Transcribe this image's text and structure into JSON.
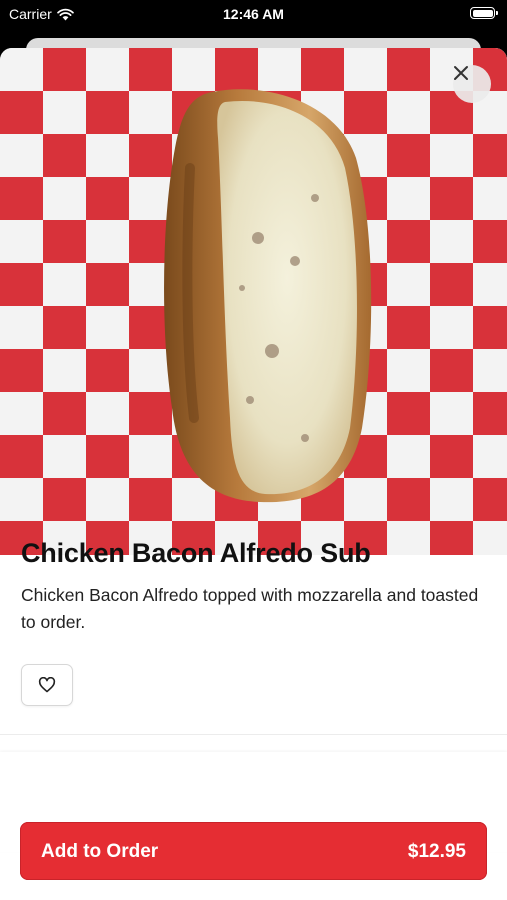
{
  "status_bar": {
    "carrier": "Carrier",
    "time": "12:46 AM"
  },
  "item": {
    "title": "Chicken Bacon Alfredo Sub",
    "description": "Chicken Bacon Alfredo topped with mozzarella and toasted to order."
  },
  "actions": {
    "add_to_order_label": "Add to Order",
    "price": "$12.95"
  },
  "icons": {
    "close": "close-icon",
    "favorite": "heart-icon",
    "wifi": "wifi-icon",
    "battery": "battery-icon"
  },
  "colors": {
    "accent": "#e52d33",
    "checker_red": "#d8323a"
  }
}
